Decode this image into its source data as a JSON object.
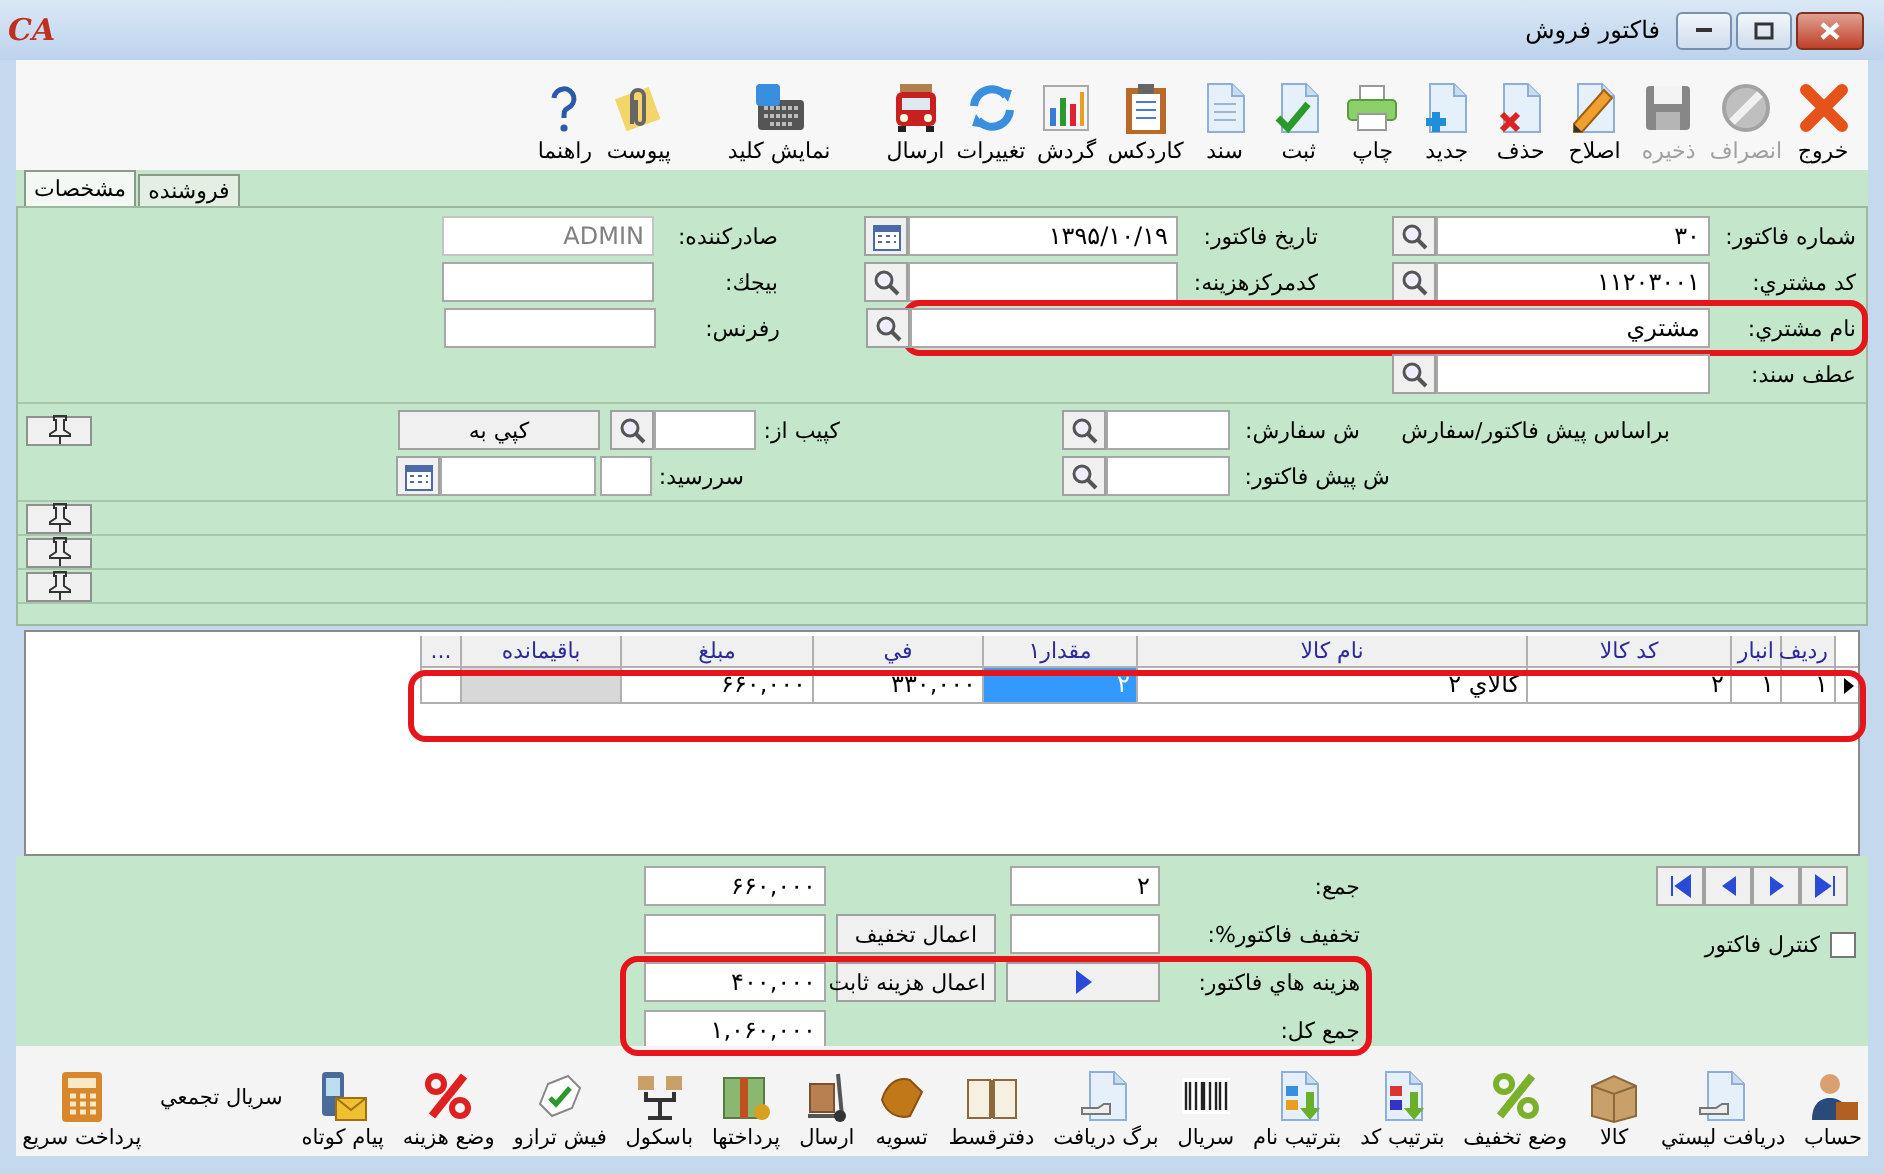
{
  "window": {
    "logo": "CA",
    "title": "فاكتور فروش"
  },
  "toolbar": [
    {
      "label": "خروج",
      "disabled": false
    },
    {
      "label": "انصراف",
      "disabled": true
    },
    {
      "label": "ذخيره",
      "disabled": true
    },
    {
      "label": "اصلاح",
      "disabled": false
    },
    {
      "label": "حذف",
      "disabled": false
    },
    {
      "label": "جديد",
      "disabled": false
    },
    {
      "label": "چاپ",
      "disabled": false
    },
    {
      "label": "ثبت",
      "disabled": false
    },
    {
      "label": "سند",
      "disabled": false
    },
    {
      "label": "كاردكس",
      "disabled": false
    },
    {
      "label": "گردش",
      "disabled": false
    },
    {
      "label": "تغييرات",
      "disabled": false
    },
    {
      "label": "ارسال",
      "disabled": false
    },
    {
      "label": "نمايش كليد",
      "disabled": false
    },
    {
      "label": "پيوست",
      "disabled": false
    },
    {
      "label": "راهنما",
      "disabled": false
    }
  ],
  "tabs": [
    {
      "label": "فروشنده",
      "selected": false
    },
    {
      "label": "مشخصات",
      "selected": true
    }
  ],
  "header_rows": [
    [
      {
        "kind": "search",
        "label": "شماره فاكتور:",
        "value": "۳۰",
        "readonly": false,
        "highlighted": false
      },
      {
        "kind": "calendar",
        "label": "تاريخ فاكتور:",
        "value": "۱۳۹۵/۱۰/۱۹",
        "readonly": false,
        "highlighted": false
      },
      {
        "kind": "plain",
        "label": "صادركننده:",
        "value": "ADMIN",
        "readonly": true,
        "highlighted": false
      }
    ],
    [
      {
        "kind": "search",
        "label": "كد مشتري:",
        "value": "۱۱۲۰۳۰۰۱",
        "readonly": false,
        "highlighted": false
      },
      {
        "kind": "search",
        "label": "كدمركزهزينه:",
        "readonly": false,
        "highlighted": false
      },
      {
        "kind": "plain",
        "label": "بيجك:",
        "readonly": false,
        "highlighted": false
      }
    ],
    [
      {
        "kind": "wide-search",
        "label": "نام مشتري:",
        "value": "مشتري",
        "readonly": false,
        "highlighted": true
      },
      {
        "kind": "plain",
        "label": "رفرنس:",
        "readonly": false,
        "highlighted": false
      }
    ],
    [
      {
        "kind": "search",
        "label": "عطف سند:",
        "readonly": false,
        "highlighted": false
      }
    ]
  ],
  "order_reference": {
    "caption": "براساس پيش فاكتور/سفارش",
    "fields": [
      {
        "label": "ش سفارش:",
        "kind": "search"
      },
      {
        "label": "ش پيش فاكتور:",
        "kind": "search"
      }
    ]
  },
  "copy": {
    "from_label": "كپيب از:",
    "button": "كپي به"
  },
  "due_date": {
    "label": "سررسيد:"
  },
  "grid": {
    "columns": [
      "رديف",
      "انبار",
      "كد كالا",
      "نام كالا",
      "مقدار۱",
      "في",
      "مبلغ",
      "باقيمانده",
      "..."
    ],
    "rows": [
      {
        "current": true,
        "highlighted": true,
        "cells": [
          {
            "text": "۱",
            "selected": false,
            "disabled": false
          },
          {
            "text": "۱",
            "selected": false,
            "disabled": false
          },
          {
            "text": "۲",
            "selected": false,
            "disabled": false
          },
          {
            "text": "كالاي ۲",
            "selected": false,
            "disabled": false
          },
          {
            "text": "۲",
            "selected": true,
            "disabled": false
          },
          {
            "text": "۳۳۰,۰۰۰",
            "selected": false,
            "disabled": false
          },
          {
            "text": "۶۶۰,۰۰۰",
            "selected": false,
            "disabled": false
          },
          {
            "selected": false,
            "disabled": true
          },
          {
            "selected": false,
            "disabled": false
          }
        ]
      }
    ]
  },
  "summary": {
    "quantity_total": {
      "label": "جمع:",
      "value": "۲"
    },
    "amount_total": "۶۶۰,۰۰۰",
    "discount": {
      "label": "تخفيف فاكتور%:",
      "button": "اعمال تخفيف"
    },
    "costs": {
      "label": "هزينه هاي فاكتور:",
      "button": "اعمال هزينه ثابت",
      "value": "۴۰۰,۰۰۰",
      "highlighted": true
    },
    "grand_total": {
      "label": "جمع كل:",
      "value": "۱,۰۶۰,۰۰۰"
    },
    "invoice_control": {
      "label": "كنترل فاكتور",
      "checked": false
    }
  },
  "bottom_toolbar": [
    {
      "label": "حساب",
      "kind": "icon"
    },
    {
      "label": "دريافت ليستي",
      "kind": "icon"
    },
    {
      "label": "كالا",
      "kind": "icon"
    },
    {
      "label": "وضع تخفيف",
      "kind": "icon"
    },
    {
      "label": "بترتيب كد",
      "kind": "icon"
    },
    {
      "label": "بترتيب نام",
      "kind": "icon"
    },
    {
      "label": "سريال",
      "kind": "icon"
    },
    {
      "label": "برگ دريافت",
      "kind": "icon"
    },
    {
      "label": "دفترقسط",
      "kind": "icon"
    },
    {
      "label": "تسويه",
      "kind": "icon"
    },
    {
      "label": "ارسال",
      "kind": "icon"
    },
    {
      "label": "پرداختها",
      "kind": "icon"
    },
    {
      "label": "باسكول",
      "kind": "icon"
    },
    {
      "label": "فيش ترازو",
      "kind": "icon"
    },
    {
      "label": "وضع هزينه",
      "kind": "icon"
    },
    {
      "label": "پيام كوتاه",
      "kind": "icon"
    },
    {
      "label": "سريال تجمعي",
      "kind": "text"
    },
    {
      "label": "پرداخت سريع",
      "kind": "icon"
    }
  ]
}
